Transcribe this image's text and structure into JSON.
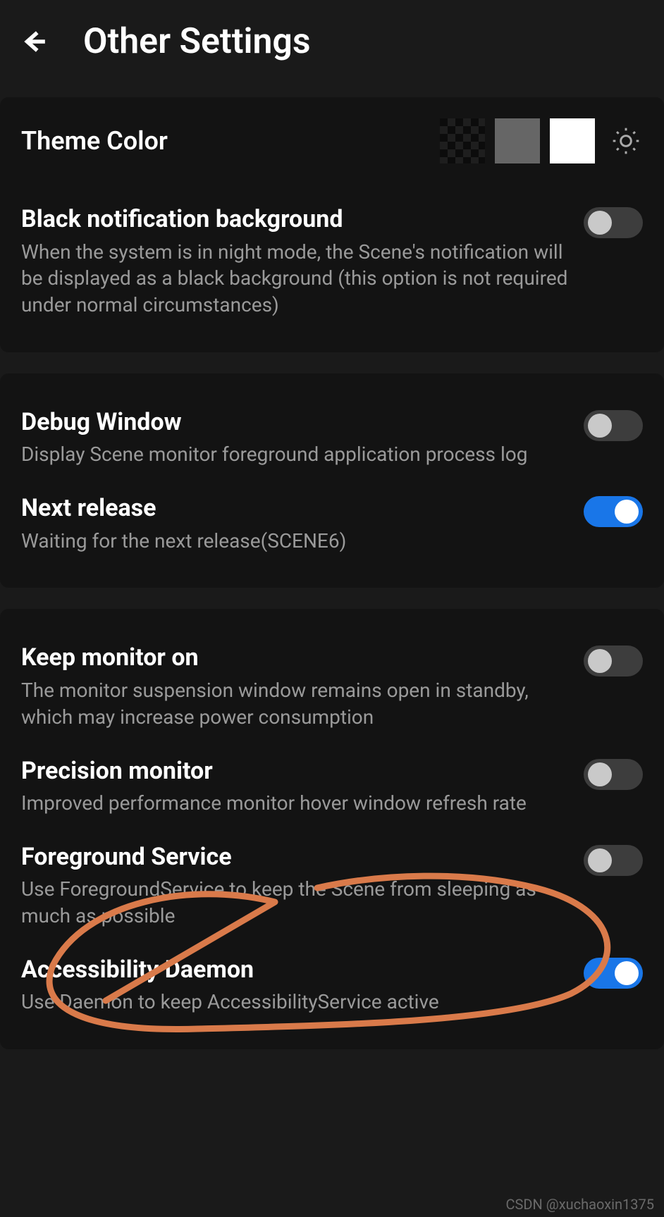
{
  "header": {
    "title": "Other Settings"
  },
  "theme": {
    "label": "Theme Color",
    "swatches": [
      "checker",
      "gray",
      "white"
    ]
  },
  "panels": [
    {
      "rows": [
        {
          "key": "black-notif",
          "title": "Black notification background",
          "desc": "When the system is in night mode, the Scene's notification will be displayed as a black background (this option is not required under normal circumstances)",
          "on": false
        }
      ]
    },
    {
      "rows": [
        {
          "key": "debug-window",
          "title": "Debug Window",
          "desc": "Display Scene monitor foreground application process log",
          "on": false
        },
        {
          "key": "next-release",
          "title": "Next release",
          "desc": "Waiting for the next release(SCENE6)",
          "on": true
        }
      ]
    },
    {
      "rows": [
        {
          "key": "keep-monitor",
          "title": "Keep monitor on",
          "desc": "The monitor suspension window remains open in standby, which may increase power consumption",
          "on": false
        },
        {
          "key": "precision-monitor",
          "title": "Precision monitor",
          "desc": "Improved performance monitor hover window refresh rate",
          "on": false
        },
        {
          "key": "foreground-service",
          "title": "Foreground Service",
          "desc": "Use ForegroundService to keep the Scene from sleeping as much as possible",
          "on": false
        },
        {
          "key": "accessibility-daemon",
          "title": "Accessibility Daemon",
          "desc": "Use Daemon to keep AccessibilityService active",
          "on": true
        }
      ]
    }
  ],
  "watermark": "CSDN @xuchaoxin1375",
  "annotation_color": "#d97a4a"
}
